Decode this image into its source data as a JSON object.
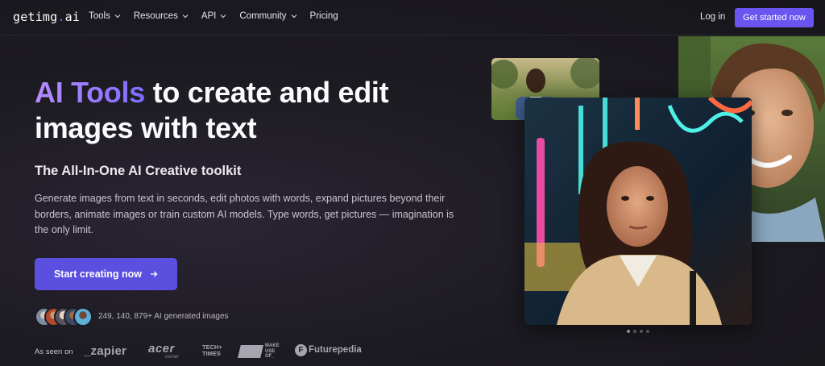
{
  "nav": {
    "logo_main": "getimg",
    "logo_dot": ".",
    "logo_tail": "ai",
    "items": [
      {
        "label": "Tools",
        "has_dropdown": true
      },
      {
        "label": "Resources",
        "has_dropdown": true
      },
      {
        "label": "API",
        "has_dropdown": true
      },
      {
        "label": "Community",
        "has_dropdown": true
      },
      {
        "label": "Pricing",
        "has_dropdown": false
      }
    ],
    "login": "Log in",
    "get_started": "Get started now"
  },
  "hero": {
    "headline_accent": "AI Tools",
    "headline_line1_rest": " to create and edit",
    "headline_line2": "images with text",
    "subtitle": "The All-In-One AI Creative toolkit",
    "description": "Generate images from text in seconds, edit photos with words, expand pictures beyond their borders, animate images or train custom AI models. Type words, get pictures — imagination is the only limit.",
    "cta": "Start creating now",
    "cta_icon": "arrow-right-icon",
    "generated_count": "249, 140, 879+ AI generated images"
  },
  "press": {
    "label": "As seen on",
    "logos": [
      "_zapier",
      "acer",
      "corner",
      "TECH+ TIMES",
      "MAKE USE OF_",
      "Futurepedia"
    ]
  },
  "colors": {
    "accent": "#6a55f0",
    "cta": "#5b4fe0",
    "gradient_start": "#b68cff",
    "gradient_end": "#7b6cff",
    "background": "#1d1b22"
  },
  "carousel": {
    "slides": 4,
    "active_index": 0
  }
}
